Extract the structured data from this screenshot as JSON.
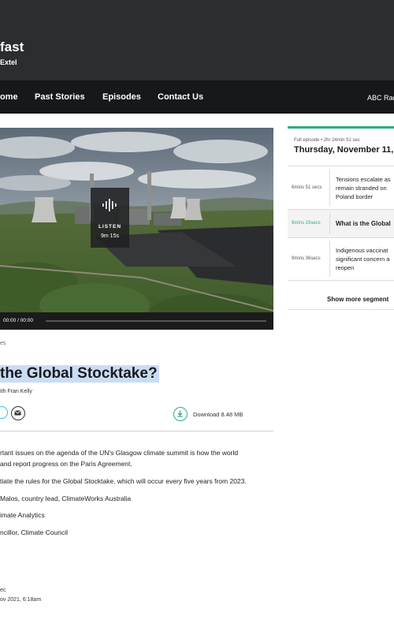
{
  "header": {
    "show_title": "fast",
    "show_subtitle": "Extel"
  },
  "nav": {
    "items": [
      "ome",
      "Past Stories",
      "Episodes",
      "Contact Us"
    ],
    "right_label": "ABC Rad"
  },
  "player": {
    "listen_label": "LISTEN",
    "duration": "9m 15s",
    "time_display": "00:00 / 00:00"
  },
  "story": {
    "breadcrumb": "es",
    "title": " the Global Stocktake?",
    "byline": "ith Fran Kelly",
    "download_label": "Download 8.48 MB",
    "paragraphs": [
      "rtant issues on the agenda of the UN's Glasgow climate summit is how the world",
      "and report progress on the Paris Agreement.",
      "tiate the rules for the Global Stocktake, which will occur every five years from 2023.",
      "Malos, country lead, ClimateWorks Australia",
      "imate Analytics",
      "ncillor, Climate Council"
    ],
    "meta_duration": "ec",
    "meta_date": "ov 2021, 6:18am"
  },
  "episode_panel": {
    "full_episode_label": "Full episode • 2hr 24min 51 sec",
    "date": "Thursday, November 11, 2",
    "segments": [
      {
        "time": "6mins 51 secs",
        "lines": [
          "Tensions escalate as",
          "remain stranded on",
          "Poland border"
        ]
      },
      {
        "time": "9mins 15secs",
        "lines": [
          "What is the Global"
        ]
      },
      {
        "time": "9mins 36secs",
        "lines": [
          "Indigenous vaccinat",
          "significant concern a",
          "reopen"
        ]
      }
    ],
    "show_more": "Show more segment"
  },
  "colors": {
    "accent_green": "#2dae7f",
    "header_bg": "#2b2e31",
    "nav_bg": "#16181a",
    "highlight": "#c9dcf6"
  }
}
